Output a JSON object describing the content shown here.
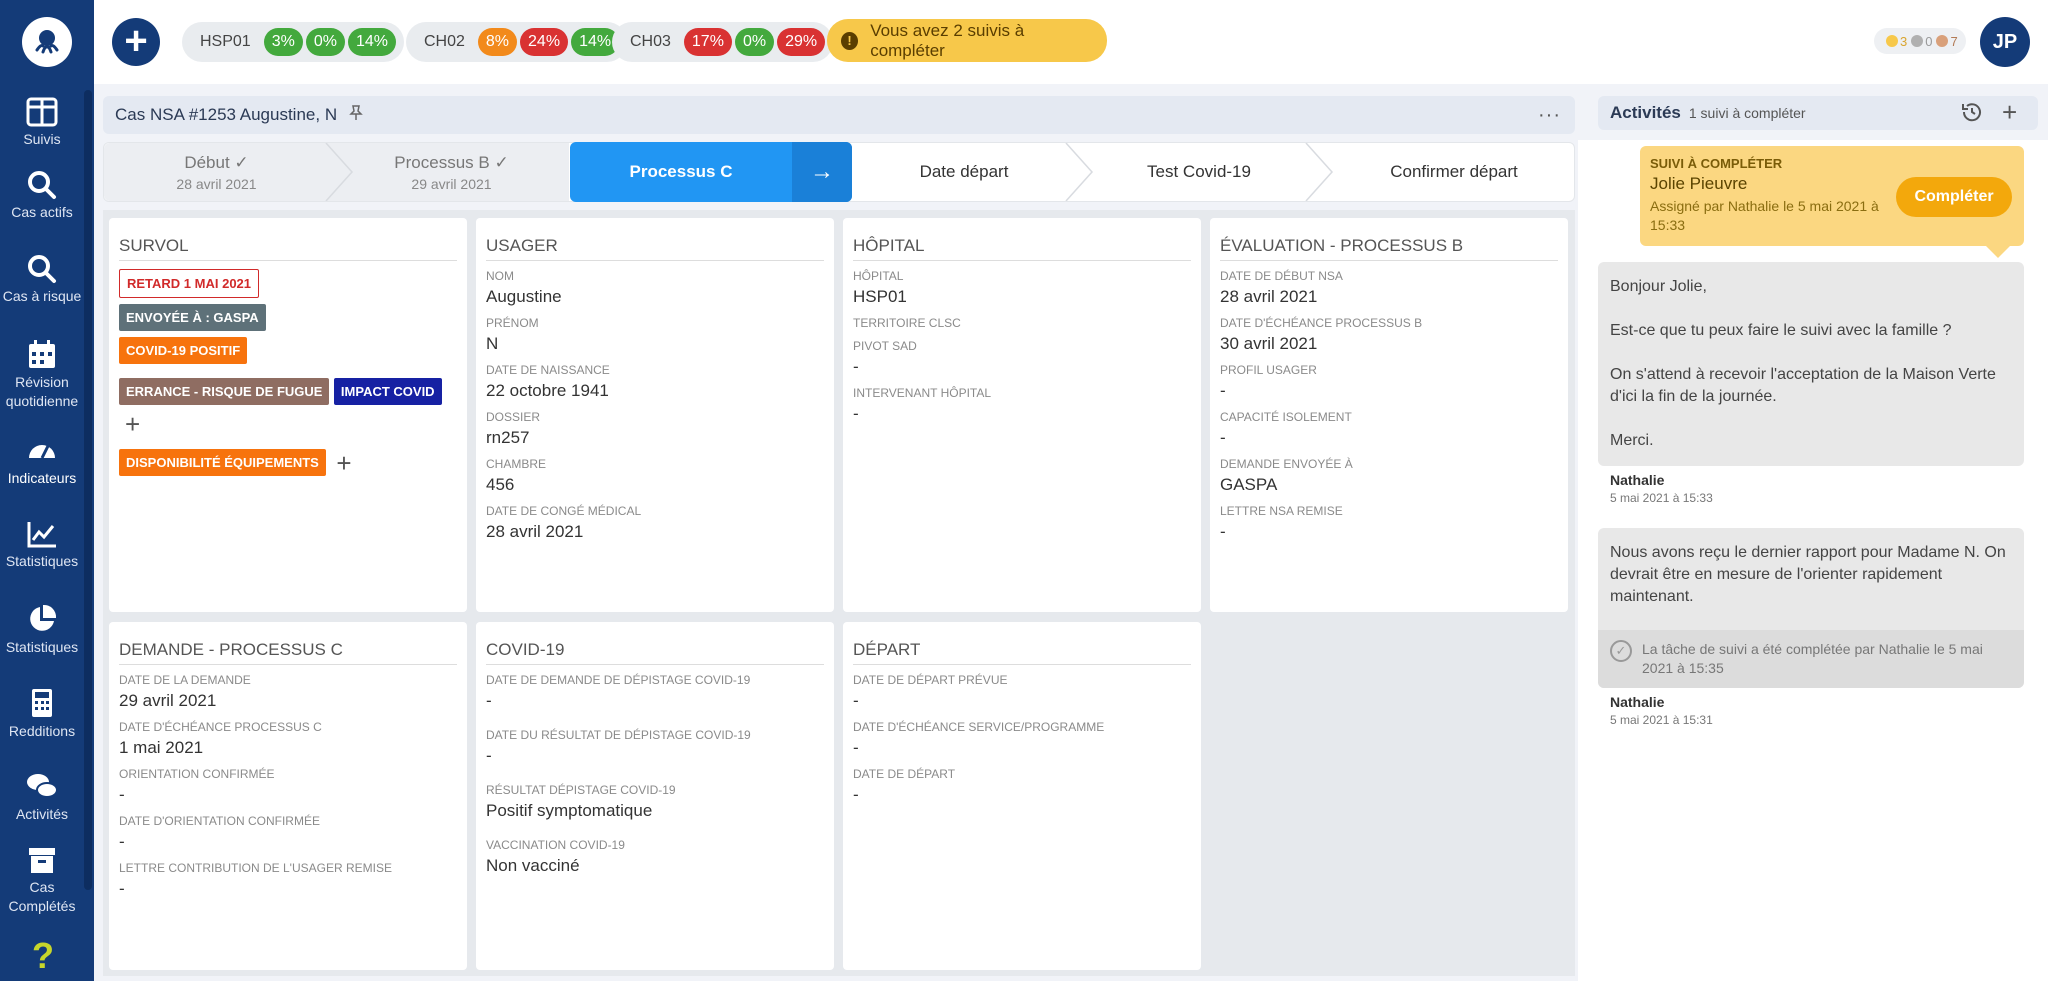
{
  "nav": {
    "items": [
      {
        "label": "Suivis",
        "icon": "columns-icon"
      },
      {
        "label": "Cas actifs",
        "icon": "search-icon"
      },
      {
        "label": "Cas à risque",
        "icon": "search-icon"
      },
      {
        "label": "Révision quotidienne",
        "icon": "calendar-icon"
      },
      {
        "label": "Indicateurs",
        "icon": "gauge-icon"
      },
      {
        "label": "Statistiques",
        "icon": "line-chart-icon"
      },
      {
        "label": "Statistiques",
        "icon": "pie-chart-icon"
      },
      {
        "label": "Redditions",
        "icon": "calculator-icon"
      },
      {
        "label": "Activités",
        "icon": "chat-icon"
      },
      {
        "label": "Cas Complétés",
        "icon": "archive-icon"
      }
    ],
    "help": "?"
  },
  "topbar": {
    "add": "+",
    "sites": [
      {
        "name": "HSP01",
        "pills": [
          {
            "v": "3%",
            "c": "green"
          },
          {
            "v": "0%",
            "c": "green"
          },
          {
            "v": "14%",
            "c": "green"
          }
        ]
      },
      {
        "name": "CH02",
        "pills": [
          {
            "v": "8%",
            "c": "orange"
          },
          {
            "v": "24%",
            "c": "red"
          },
          {
            "v": "14%",
            "c": "green"
          }
        ]
      },
      {
        "name": "CH03",
        "pills": [
          {
            "v": "17%",
            "c": "red"
          },
          {
            "v": "0%",
            "c": "green"
          },
          {
            "v": "29%",
            "c": "red"
          }
        ]
      }
    ],
    "alert": "Vous avez 2 suivis à compléter",
    "counts": [
      {
        "v": "3",
        "color": "#f7c84a"
      },
      {
        "v": "0",
        "color": "#b0b0b0"
      },
      {
        "v": "7",
        "color": "#d9a07a"
      }
    ],
    "avatar": "JP"
  },
  "case": {
    "title_prefix": "Cas NSA #",
    "title": "1253 Augustine, N"
  },
  "steps": [
    {
      "label": "Début ✓",
      "date": "28 avril 2021"
    },
    {
      "label": "Processus B ✓",
      "date": "29 avril 2021"
    },
    {
      "label": "Processus C"
    },
    {
      "label": "Date départ"
    },
    {
      "label": "Test Covid-19"
    },
    {
      "label": "Confirmer départ"
    }
  ],
  "survol": {
    "title": "Survol",
    "tags": [
      "Retard 1 mai 2021",
      "Envoyée à : GASPA",
      "COVID-19 Positif",
      "Errance - Risque de fugue",
      "Impact COVID",
      "Disponibilité équipements"
    ]
  },
  "usager": {
    "title": "Usager",
    "fields": [
      {
        "label": "Nom",
        "value": "Augustine"
      },
      {
        "label": "Prénom",
        "value": "N"
      },
      {
        "label": "Date de naissance",
        "value": "22 octobre 1941"
      },
      {
        "label": "Dossier",
        "value": "rn257"
      },
      {
        "label": "Chambre",
        "value": "456"
      },
      {
        "label": "Date de congé médical",
        "value": "28 avril 2021"
      }
    ]
  },
  "hopital": {
    "title": "Hôpital",
    "fields": [
      {
        "label": "Hôpital",
        "value": "HSP01"
      },
      {
        "label": "Territoire CLSC",
        "value": ""
      },
      {
        "label": "Pivot SAD",
        "value": "-"
      },
      {
        "label": "Intervenant hôpital",
        "value": "-"
      }
    ]
  },
  "evaluation": {
    "title": "Évaluation - Processus B",
    "fields": [
      {
        "label": "Date de début NSA",
        "value": "28 avril 2021"
      },
      {
        "label": "Date d'échéance processus B",
        "value": "30 avril 2021"
      },
      {
        "label": "Profil usager",
        "value": "-"
      },
      {
        "label": "Capacité isolement",
        "value": "-"
      },
      {
        "label": "Demande envoyée à",
        "value": "GASPA"
      },
      {
        "label": "Lettre NSA remise",
        "value": "-"
      }
    ]
  },
  "demande": {
    "title": "Demande - Processus C",
    "fields": [
      {
        "label": "Date de la demande",
        "value": "29 avril 2021"
      },
      {
        "label": "Date d'échéance processus C",
        "value": "1 mai 2021"
      },
      {
        "label": "Orientation confirmée",
        "value": "-"
      },
      {
        "label": "Date d'orientation confirmée",
        "value": "-"
      },
      {
        "label": "Lettre contribution de l'usager remise",
        "value": "-"
      }
    ]
  },
  "covid": {
    "title": "COVID-19",
    "fields": [
      {
        "label": "Date de demande de dépistage COVID-19",
        "value": "-"
      },
      {
        "label": "Date du résultat de dépistage COVID-19",
        "value": "-"
      },
      {
        "label": "Résultat dépistage COVID-19",
        "value": "Positif symptomatique"
      },
      {
        "label": "Vaccination COVID-19",
        "value": "Non vacciné"
      }
    ]
  },
  "depart": {
    "title": "Départ",
    "fields": [
      {
        "label": "Date de départ prévue",
        "value": "-"
      },
      {
        "label": "Date d'échéance service/programme",
        "value": "-"
      },
      {
        "label": "Date de départ",
        "value": "-"
      }
    ]
  },
  "activities": {
    "title": "Activités",
    "subtitle": "1 suivi à compléter",
    "suivi": {
      "kicker": "SUIVI À COMPLÉTER",
      "name": "Jolie Pieuvre",
      "assigned": "Assigné par Nathalie le 5 mai 2021 à 15:33",
      "button": "Compléter"
    },
    "messages": [
      {
        "lines": [
          "Bonjour Jolie,",
          "Est-ce que tu peux faire le suivi avec la famille ?",
          "On s'attend à recevoir l'acceptation de la Maison Verte d'ici la fin de la journée.",
          "Merci."
        ],
        "author": "Nathalie",
        "date": "5 mai 2021 à 15:33"
      },
      {
        "lines": [
          "Nous avons reçu le dernier rapport pour Madame N. On devrait être en mesure de l'orienter rapidement maintenant."
        ],
        "done": "La tâche de suivi a été complétée par Nathalie le 5 mai 2021 à 15:35",
        "author": "Nathalie",
        "date": "5 mai 2021 à 15:31"
      }
    ]
  }
}
